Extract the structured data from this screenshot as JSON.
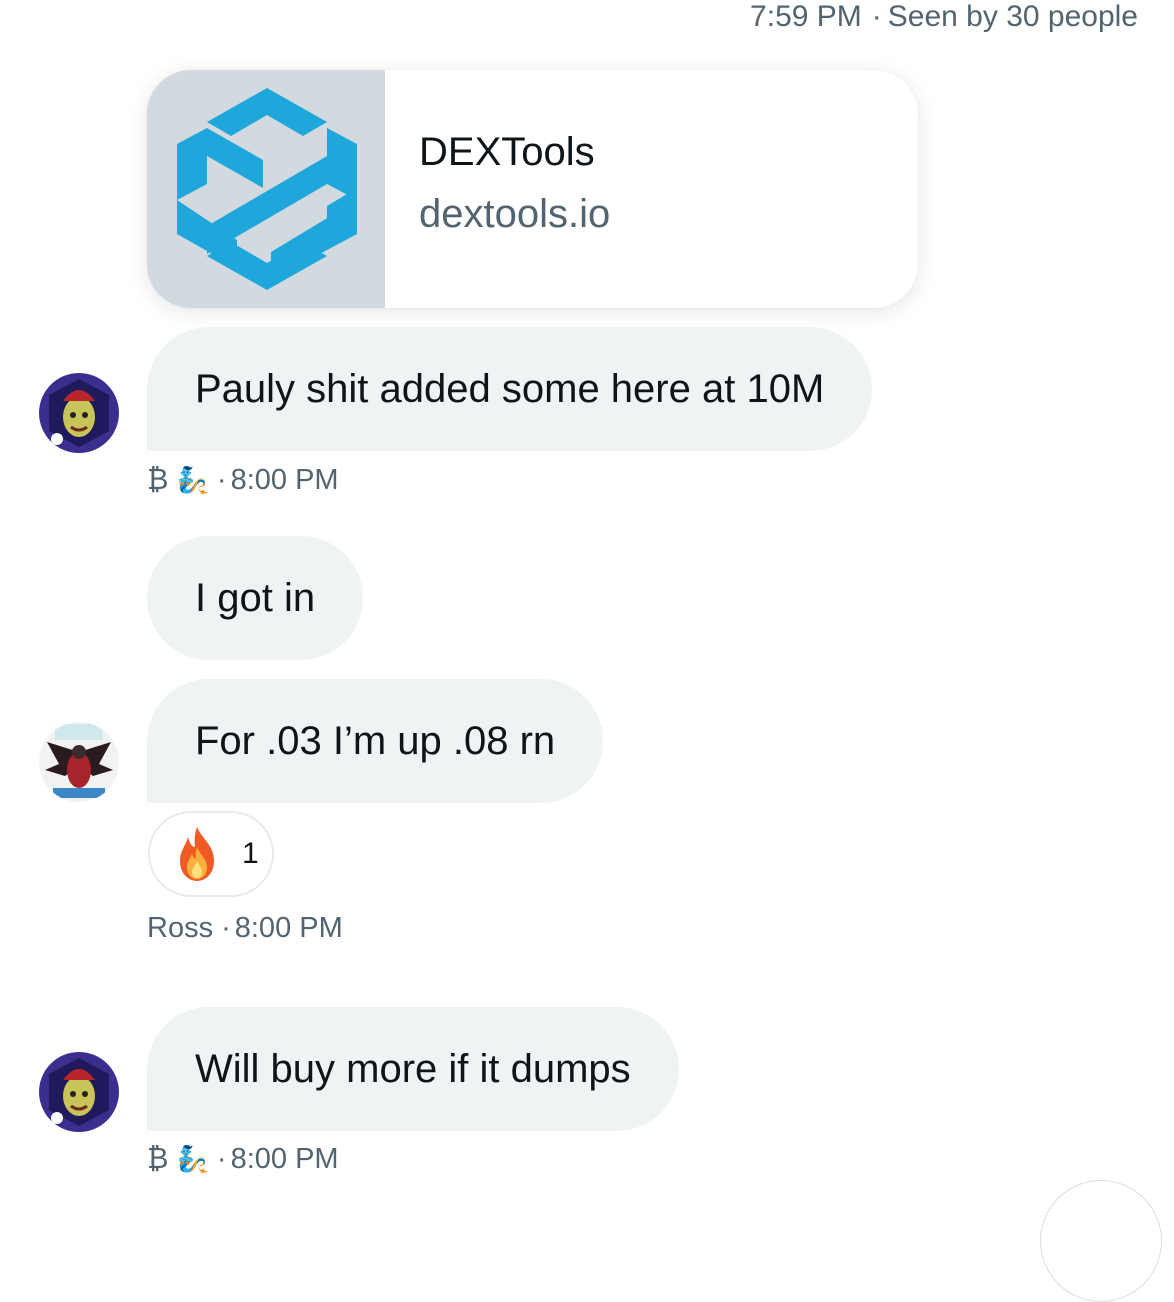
{
  "header": {
    "time": "7:59 PM",
    "separator": "·",
    "seen_text": "Seen by 30 people"
  },
  "link_card": {
    "title": "DEXTools",
    "domain": "dextools.io",
    "thumbnail_icon": "dextools-logo-icon",
    "thumbnail_bg": "#d2d9df",
    "logo_color": "#1fa7dc"
  },
  "messages": [
    {
      "text": "Pauly shit added some here at 10M",
      "sender_symbol": "₿",
      "sender_emoji": "🧞",
      "separator": "·",
      "time": "8:00 PM"
    },
    {
      "text": "I got in"
    },
    {
      "text": "For .03 I’m up .08 rn",
      "reaction": {
        "icon": "fire-emoji-icon",
        "count": "1"
      },
      "sender_name": "Ross",
      "separator": "·",
      "time": "8:00 PM"
    },
    {
      "text": "Will buy more if it dumps",
      "sender_symbol": "₿",
      "sender_emoji": "🧞",
      "separator": "·",
      "time": "8:00 PM"
    }
  ],
  "colors": {
    "bubble_bg": "#eff3f4",
    "text_primary": "#0f1419",
    "text_secondary": "#536471"
  }
}
